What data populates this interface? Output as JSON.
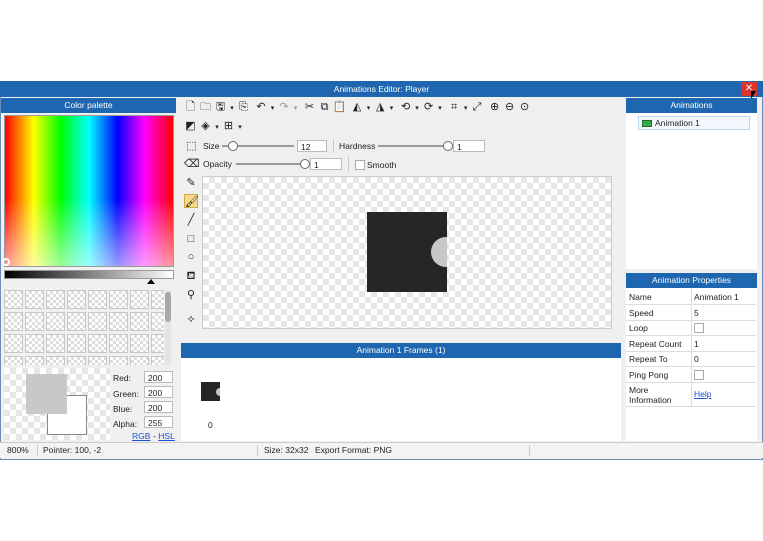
{
  "window": {
    "title": "Animations Editor: Player",
    "close_glyph": "✕"
  },
  "palette": {
    "header": "Color palette",
    "rgb": {
      "red_label": "Red:",
      "red": "200",
      "green_label": "Green:",
      "green": "200",
      "blue_label": "Blue:",
      "blue": "200",
      "alpha_label": "Alpha:",
      "alpha": "255"
    },
    "mode_rgb": "RGB",
    "mode_sep": "-",
    "mode_hsl": "HSL"
  },
  "toolbar": {
    "size_label": "Size",
    "size_value": "12",
    "hardness_label": "Hardness",
    "hardness_value": "1",
    "opacity_label": "Opacity",
    "opacity_value": "1",
    "smooth_label": "Smooth",
    "icons": [
      "new-file-icon",
      "open-folder-icon",
      "save-icon",
      "export-icon",
      "undo-icon",
      "redo-icon",
      "cut-icon",
      "copy-icon",
      "paste-icon",
      "flip-horizontal-icon",
      "flip-vertical-icon",
      "rotate-left-icon",
      "rotate-right-icon",
      "crop-icon",
      "resize-icon",
      "zoom-in-icon",
      "zoom-out-icon",
      "zoom-reset-icon"
    ]
  },
  "frames": {
    "header": "Animation 1 Frames (1)",
    "frame_label": "0"
  },
  "animations": {
    "header": "Animations",
    "items": [
      {
        "label": "Animation 1"
      }
    ]
  },
  "properties": {
    "header": "Animation Properties",
    "name_label": "Name",
    "name_value": "Animation 1",
    "speed_label": "Speed",
    "speed_value": "5",
    "loop_label": "Loop",
    "repeat_count_label": "Repeat Count",
    "repeat_count_value": "1",
    "repeat_to_label": "Repeat To",
    "repeat_to_value": "0",
    "ping_pong_label": "Ping Pong",
    "more_info_label": "More\nInformation",
    "help_link": "Help"
  },
  "status": {
    "zoom": "800%",
    "pointer": "Pointer: 100, -2",
    "size": "Size: 32x32",
    "export_format": "Export Format: PNG"
  },
  "colors": {
    "accent": "#1e67b0",
    "close": "#d9352c",
    "sprite": "#262626",
    "sprite_notch": "#c8c8c8"
  }
}
